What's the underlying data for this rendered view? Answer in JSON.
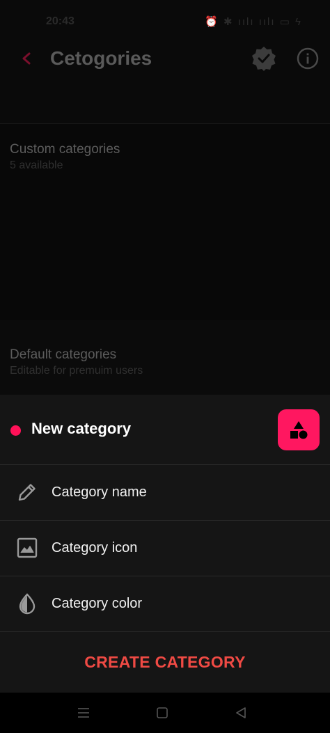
{
  "status_bar": {
    "time": "20:43",
    "icons_text": "⏰ ✱ ıılı ıılı ▭ ϟ"
  },
  "toolbar": {
    "title": "Cetogories",
    "back_icon": "chevron-left-icon",
    "verified_icon": "verified-badge-icon",
    "info_icon": "info-icon"
  },
  "sections": {
    "custom": {
      "title": "Custom categories",
      "subtitle": "5 available"
    },
    "default": {
      "title": "Default categories",
      "subtitle": "Editable for premuim users"
    }
  },
  "sheet": {
    "title": "New category",
    "color_dot": "#ff1158",
    "preview_bg": "#ff1760",
    "preview_icon": "shapes-icon",
    "rows": [
      {
        "label": "Category name",
        "icon": "pencil-icon"
      },
      {
        "label": "Category icon",
        "icon": "image-icon"
      },
      {
        "label": "Category color",
        "icon": "color-drop-icon"
      }
    ],
    "create_label": "CREATE CATEGORY",
    "create_color": "#ef4a44"
  },
  "nav_bar": {
    "items": [
      "menu-icon",
      "home-square-icon",
      "back-triangle-icon"
    ]
  }
}
